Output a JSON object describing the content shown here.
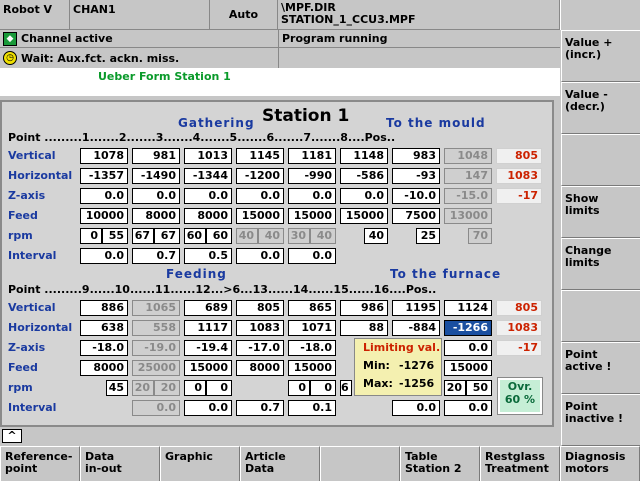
{
  "header": {
    "robot": "Robot V",
    "channel": "CHAN1",
    "mode": "Auto",
    "path": "\\MPF.DIR",
    "program": "STATION_1_CCU3.MPF"
  },
  "status": {
    "channel_state": "Channel active",
    "program_state": "Program running",
    "alarm": "Wait: Aux.fct. ackn. miss.",
    "form_title": "Ueber Form Station 1"
  },
  "main": {
    "title": "Station 1",
    "group1": "Gathering",
    "group2": "To the  mould",
    "group3": "Feeding",
    "group4": "To the  furnace",
    "point_row1": "Point .........1.......2.......3.......4.......5.......6.......7.......8....Pos..",
    "point_row2": "Point .........9......10......11......12...>6...13......14......15......16....Pos..",
    "labels": [
      "Vertical",
      "Horizontal",
      "Z-axis",
      "Feed",
      "rpm",
      "Interval"
    ],
    "top": {
      "vertical": [
        "1078",
        "981",
        "1013",
        "1145",
        "1181",
        "1148",
        "983",
        "1048"
      ],
      "vertical_pos": "805",
      "horizontal": [
        "-1357",
        "-1490",
        "-1344",
        "-1200",
        "-990",
        "-586",
        "-93",
        "147"
      ],
      "horizontal_pos": "1083",
      "z": [
        "0.0",
        "0.0",
        "0.0",
        "0.0",
        "0.0",
        "0.0",
        "-10.0",
        "-15.0"
      ],
      "z_pos": "-17",
      "feed": [
        "10000",
        "8000",
        "8000",
        "15000",
        "15000",
        "15000",
        "7500",
        "13000"
      ],
      "rpm": [
        "0",
        "55",
        "67",
        "67",
        "60",
        "60",
        "40",
        "40",
        "30",
        "40",
        "40",
        "25",
        "70"
      ],
      "interval": [
        "0.0",
        "0.7",
        "0.5",
        "0.0",
        "0.0"
      ]
    },
    "bottom": {
      "vertical": [
        "886",
        "1065",
        "689",
        "805",
        "865",
        "986",
        "1195",
        "1124"
      ],
      "vertical_pos": "805",
      "horizontal": [
        "638",
        "558",
        "1117",
        "1083",
        "1071",
        "88",
        "-884",
        "-1266"
      ],
      "horizontal_pos": "1083",
      "z": [
        "-18.0",
        "-19.0",
        "-19.4",
        "-17.0",
        "-18.0",
        "0.0"
      ],
      "z_pos": "-17",
      "feed": [
        "8000",
        "25000",
        "15000",
        "8000",
        "15000",
        "15000"
      ],
      "rpm": [
        "45",
        "20",
        "20",
        "0",
        "0",
        "0",
        "0",
        "6",
        "20",
        "50"
      ],
      "interval": [
        "0.0",
        "0.0",
        "0.7",
        "0.1",
        "0.0",
        "0.0"
      ]
    },
    "limit": {
      "title": "Limiting val.",
      "min_label": "Min:",
      "min": "-1276",
      "max_label": "Max:",
      "max": "-1256"
    },
    "ovr": {
      "label": "Ovr.",
      "value": "60 %"
    }
  },
  "softkeys_v": [
    "Value +\n(incr.)",
    "Value -\n(decr.)",
    "",
    "Show\nlimits",
    "Change\nlimits",
    "",
    "Point\nactive !",
    "Point\ninactive !"
  ],
  "softkeys_h": [
    "Reference-\npoint",
    "Data\nin-out",
    "Graphic",
    "Article\nData",
    "",
    "Table\nStation 2",
    "Restglass\nTreatment",
    "Diagnosis\nmotors"
  ],
  "up_arrow": "^"
}
